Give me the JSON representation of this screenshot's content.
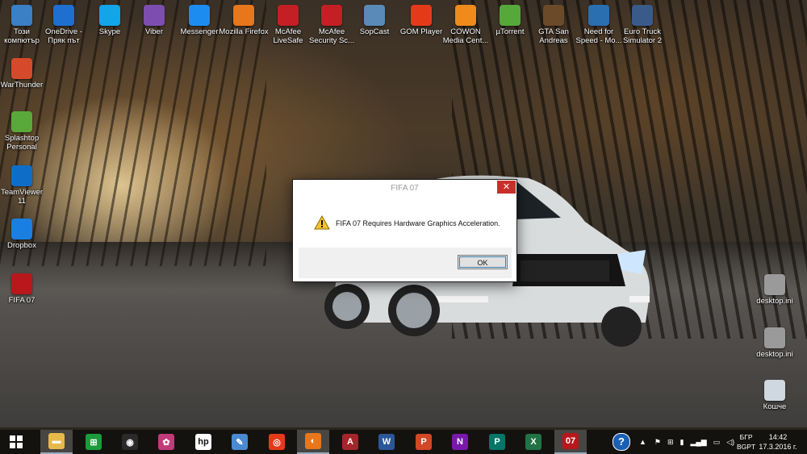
{
  "desktop": {
    "top_icons": [
      {
        "label": "Този компютър",
        "icon": "computer-icon",
        "color": "#3b7fc4"
      },
      {
        "label": "OneDrive - Пряк път",
        "icon": "onedrive-icon",
        "color": "#1e6fd0"
      },
      {
        "label": "Skype",
        "icon": "skype-icon",
        "color": "#12a5e8"
      },
      {
        "label": "Viber",
        "icon": "viber-icon",
        "color": "#7d4eb0"
      },
      {
        "label": "Messenger",
        "icon": "messenger-icon",
        "color": "#1d8cf0"
      },
      {
        "label": "Mozilla Firefox",
        "icon": "firefox-icon",
        "color": "#e8761b"
      },
      {
        "label": "McAfee LiveSafe",
        "icon": "mcafee-icon",
        "color": "#c31f25"
      },
      {
        "label": "McAfee Security Sc...",
        "icon": "mcafee-security-icon",
        "color": "#c31f25"
      },
      {
        "label": "SopCast",
        "icon": "sopcast-icon",
        "color": "#5a8bb8"
      },
      {
        "label": "GOM Player",
        "icon": "gom-player-icon",
        "color": "#e53a1a"
      },
      {
        "label": "COWON Media Cent...",
        "icon": "cowon-icon",
        "color": "#f08a1a"
      },
      {
        "label": "µTorrent",
        "icon": "utorrent-icon",
        "color": "#56a83a"
      },
      {
        "label": "GTA San Andreas",
        "icon": "gta-icon",
        "color": "#6b4a2a"
      },
      {
        "label": "Need for Speed - Mo...",
        "icon": "nfs-icon",
        "color": "#2a6fb0"
      },
      {
        "label": "Euro Truck Simulator 2",
        "icon": "truck-icon",
        "color": "#3a5a8a"
      }
    ],
    "left_icons": [
      {
        "label": "WarThunder",
        "icon": "warthunder-icon",
        "color": "#d44a2a"
      },
      {
        "label": "Splashtop Personal",
        "icon": "splashtop-icon",
        "color": "#5aa83a"
      },
      {
        "label": "TeamViewer 11",
        "icon": "teamviewer-icon",
        "color": "#0e6ec7"
      },
      {
        "label": "Dropbox",
        "icon": "dropbox-icon",
        "color": "#1a7fe0"
      },
      {
        "label": "FIFA 07",
        "icon": "fifa-icon",
        "color": "#b8171c"
      }
    ],
    "right_icons": [
      {
        "label": "desktop.ini",
        "icon": "settings-file-icon",
        "color": "#9a9a9a"
      },
      {
        "label": "desktop.ini",
        "icon": "settings-file-icon",
        "color": "#9a9a9a"
      },
      {
        "label": "Кошче",
        "icon": "recycle-bin-icon",
        "color": "#cfd8e0"
      }
    ]
  },
  "dialog": {
    "title": "FIFA 07",
    "close_label": "✕",
    "message": "FIFA 07 Requires Hardware Graphics Acceleration.",
    "ok_label": "OK",
    "icon": "warning-icon"
  },
  "taskbar": {
    "apps": [
      {
        "name": "file-explorer",
        "icon": "folder-icon",
        "color": "#e7b94a",
        "glyph": "▬",
        "active": true
      },
      {
        "name": "store",
        "icon": "store-icon",
        "color": "#1a9c3a",
        "glyph": "⊞",
        "active": false
      },
      {
        "name": "webcam",
        "icon": "webcam-icon",
        "color": "#2a2a2a",
        "glyph": "◉",
        "active": false
      },
      {
        "name": "photo-app",
        "icon": "photos-icon",
        "color": "#c23a7a",
        "glyph": "✿",
        "active": false
      },
      {
        "name": "hp",
        "icon": "hp-icon",
        "color": "#ffffff",
        "glyph": "hp",
        "active": false
      },
      {
        "name": "paint",
        "icon": "paint-icon",
        "color": "#4a8ad0",
        "glyph": "✎",
        "active": false
      },
      {
        "name": "gom",
        "icon": "gom-player-icon",
        "color": "#e53a1a",
        "glyph": "◎",
        "active": false
      },
      {
        "name": "firefox",
        "icon": "firefox-icon",
        "color": "#e8761b",
        "glyph": "◐",
        "active": true
      },
      {
        "name": "access",
        "icon": "access-icon",
        "color": "#a4262c",
        "glyph": "A",
        "active": false
      },
      {
        "name": "word",
        "icon": "word-icon",
        "color": "#2b579a",
        "glyph": "W",
        "active": false
      },
      {
        "name": "powerpoint",
        "icon": "powerpoint-icon",
        "color": "#d24726",
        "glyph": "P",
        "active": false
      },
      {
        "name": "onenote",
        "icon": "onenote-icon",
        "color": "#7719aa",
        "glyph": "N",
        "active": false
      },
      {
        "name": "publisher",
        "icon": "publisher-icon",
        "color": "#077568",
        "glyph": "P",
        "active": false
      },
      {
        "name": "excel",
        "icon": "excel-icon",
        "color": "#217346",
        "glyph": "X",
        "active": false
      },
      {
        "name": "fifa",
        "icon": "fifa-icon",
        "color": "#b8171c",
        "glyph": "07",
        "active": true
      }
    ],
    "help_glyph": "?",
    "language": "БГР",
    "keyboard": "BGPT",
    "time": "14:42",
    "date": "17.3.2016 г."
  }
}
